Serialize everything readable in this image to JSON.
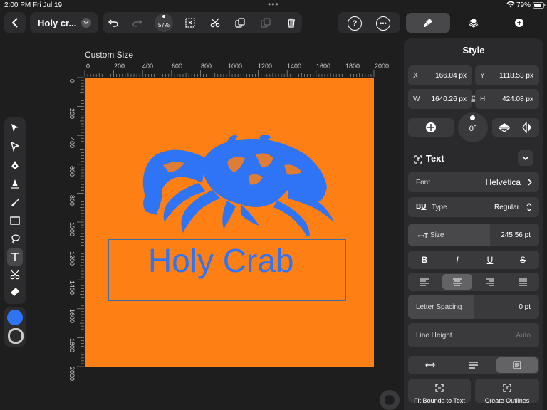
{
  "status": {
    "time": "2:00 PM",
    "date": "Fri Jul 19",
    "battery": "79%"
  },
  "document": {
    "title": "Holy cr...",
    "zoom": "57%"
  },
  "canvas": {
    "label": "Custom Size",
    "text": "Holy Crab",
    "h_ticks": [
      "0",
      "200",
      "400",
      "600",
      "800",
      "1000",
      "1200",
      "1400",
      "1600",
      "1800",
      "2000"
    ],
    "v_ticks": [
      "0",
      "200",
      "400",
      "600",
      "800",
      "1000",
      "1200",
      "1400",
      "1600",
      "1800",
      "2000"
    ],
    "bg_color": "#fe7f13",
    "accent_color": "#2f74f5"
  },
  "panel": {
    "title": "Style",
    "x_label": "X",
    "x_value": "166.04 px",
    "y_label": "Y",
    "y_value": "1118.53 px",
    "w_label": "W",
    "w_value": "1640.26 px",
    "h_label": "H",
    "h_value": "424.08 px",
    "rotation": "0°",
    "section_title": "Text",
    "font_label": "Font",
    "font_value": "Helvetica",
    "type_label": "Type",
    "type_value": "Regular",
    "size_label": "Size",
    "size_value": "245.56 pt",
    "style_bold": "B",
    "style_italic": "I",
    "style_underline": "U",
    "style_strike": "S",
    "letter_spacing_label": "Letter Spacing",
    "letter_spacing_value": "0 pt",
    "line_height_label": "Line Height",
    "line_height_value": "Auto",
    "fit_bounds_label": "Fit Bounds to Text",
    "create_outlines_label": "Create Outlines"
  }
}
